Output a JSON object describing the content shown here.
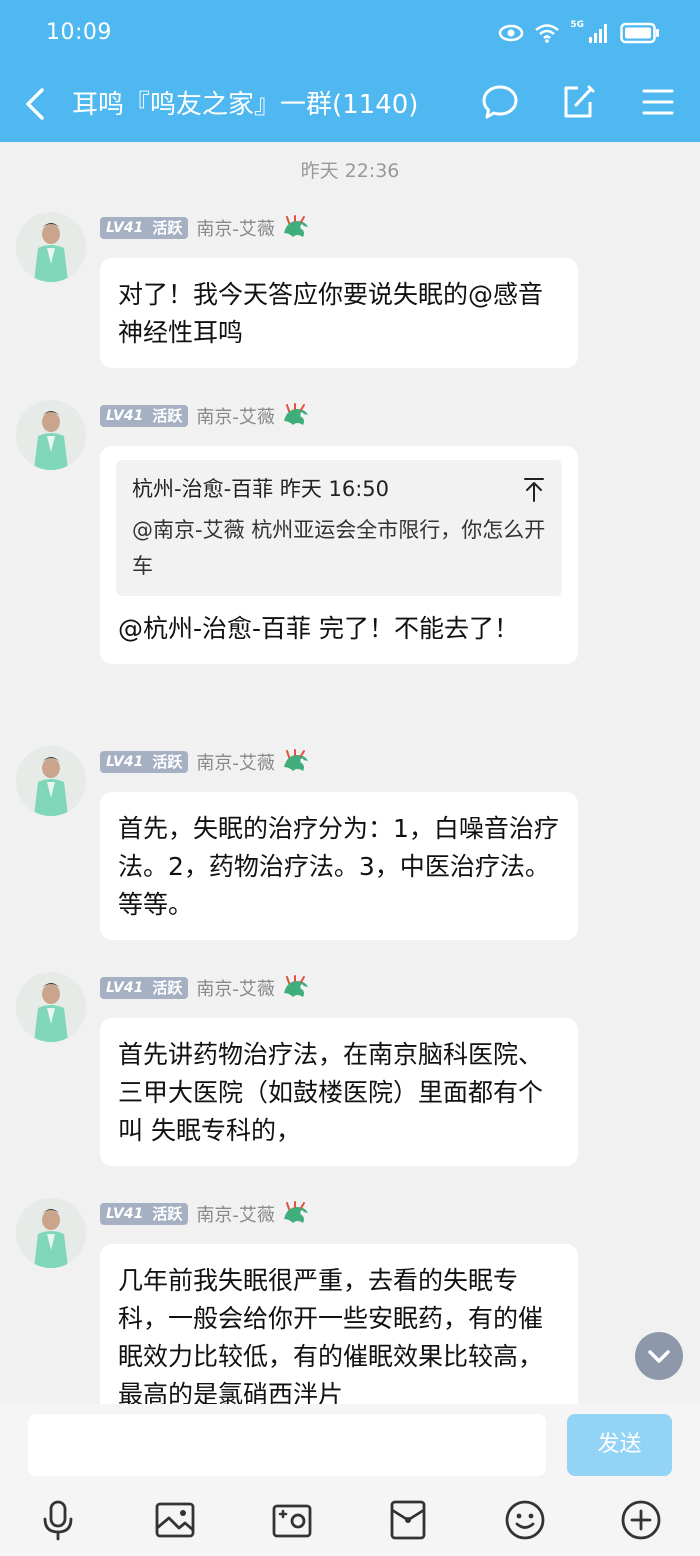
{
  "status_bar": {
    "time": "10:09",
    "network": "5G"
  },
  "header": {
    "title": "耳鸣『鸣友之家』一群(1140)"
  },
  "chat": {
    "timestamp": "昨天 22:36",
    "messages": [
      {
        "level": "LV41",
        "badge": "活跃",
        "sender": "南京-艾薇",
        "text": "对了！我今天答应你要说失眠的@感音神经性耳鸣"
      },
      {
        "level": "LV41",
        "badge": "活跃",
        "sender": "南京-艾薇",
        "quote": {
          "header": "杭州-治愈-百菲 昨天 16:50",
          "text": "@南京-艾薇 杭州亚运会全市限行，你怎么开车"
        },
        "text": "@杭州-治愈-百菲 完了！不能去了！"
      },
      {
        "level": "LV41",
        "badge": "活跃",
        "sender": "南京-艾薇",
        "text": "首先，失眠的治疗分为：1，白噪音治疗法。2，药物治疗法。3，中医治疗法。等等。"
      },
      {
        "level": "LV41",
        "badge": "活跃",
        "sender": "南京-艾薇",
        "text": "首先讲药物治疗法，在南京脑科医院、三甲大医院（如鼓楼医院）里面都有个叫 失眠专科的，"
      },
      {
        "level": "LV41",
        "badge": "活跃",
        "sender": "南京-艾薇",
        "text": "几年前我失眠很严重，去看的失眠专科，一般会给你开一些安眠药，有的催眠效力比较低，有的催眠效果比较高，最高的是氯硝西泮片"
      }
    ]
  },
  "input": {
    "placeholder": "",
    "send_label": "发送"
  },
  "colors": {
    "header_bg": "#4fb8f0",
    "send_bg": "#92d3f6",
    "badge_bg": "#a6b0c3",
    "chat_bg": "#f1f1f1"
  },
  "icons": {
    "header": [
      "back-arrow-icon",
      "chat-bubble-icon",
      "edit-icon",
      "menu-icon"
    ],
    "toolbar": [
      "microphone-icon",
      "image-icon",
      "camera-icon",
      "red-packet-icon",
      "emoji-icon",
      "plus-icon"
    ]
  }
}
